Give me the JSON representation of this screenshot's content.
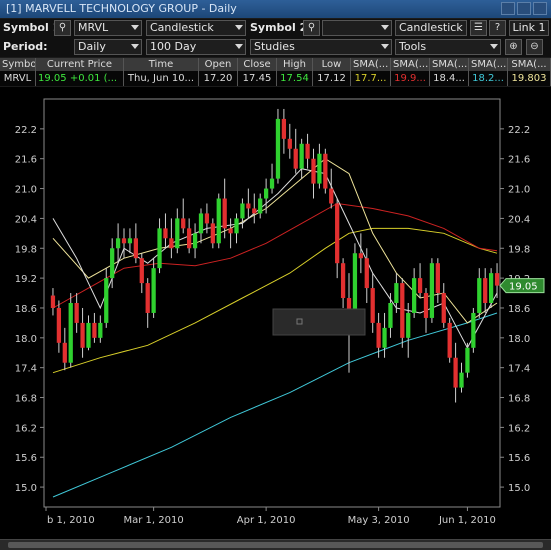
{
  "window": {
    "title": "[1] MARVELL TECHNOLOGY GROUP - Daily"
  },
  "controls": {
    "symbol1_label": "Symbol 1:",
    "symbol1_value": "MRVL",
    "charttype1": "Candlestick",
    "symbol2_label": "Symbol 2:",
    "symbol2_value": "",
    "charttype2": "Candlestick",
    "help_label": "?",
    "link_label": "Link 1",
    "period_label": "Period:",
    "period_value": "Daily",
    "range_value": "100 Day",
    "studies_value": "Studies",
    "tools_value": "Tools"
  },
  "quote": {
    "headers": [
      "Symbol",
      "Current Price",
      "Time",
      "Open",
      "Close",
      "High",
      "Low",
      "SMA(...",
      "SMA(...",
      "SMA(...",
      "SMA(...",
      "SMA(..."
    ],
    "values": [
      "MRVL",
      "19.05",
      "+0.01 (...",
      "Thu, Jun 10...",
      "17.20",
      "17.45",
      "17.54",
      "17.12",
      "17.7...",
      "19.9...",
      "18.4...",
      "18.2...",
      "19.803"
    ]
  },
  "colors": {
    "up": "#2fd12f",
    "down": "#e23030",
    "sma_red": "#cc2222",
    "sma_yellow": "#d8cf2a",
    "sma_light_yellow": "#efe49a",
    "sma_cyan": "#40c8d8",
    "sma_white": "#dddddd",
    "price_flag": "#2f8a2f"
  },
  "chart_data": {
    "type": "candlestick",
    "yaxis_ticks": [
      "22.2",
      "21.6",
      "21.0",
      "20.4",
      "19.8",
      "19.2",
      "18.6",
      "18.0",
      "17.4",
      "16.8",
      "16.2",
      "15.6",
      "15.0"
    ],
    "ylim": [
      14.6,
      22.8
    ],
    "xaxis_ticks": [
      "b 1, 2010",
      "Mar 1, 2010",
      "Apr 1, 2010",
      "May 3, 2010",
      "Jun 1, 2010"
    ],
    "last_price_label": "19.05",
    "candles": [
      [
        18.85,
        19.0,
        18.45,
        18.6
      ],
      [
        18.6,
        18.75,
        17.7,
        17.9
      ],
      [
        17.9,
        18.2,
        17.35,
        17.5
      ],
      [
        17.5,
        18.9,
        17.4,
        18.7
      ],
      [
        18.7,
        18.9,
        18.1,
        18.3
      ],
      [
        18.3,
        18.6,
        17.6,
        17.8
      ],
      [
        17.8,
        18.45,
        17.75,
        18.3
      ],
      [
        18.3,
        18.5,
        17.9,
        18.0
      ],
      [
        18.0,
        18.45,
        17.9,
        18.3
      ],
      [
        18.3,
        19.4,
        18.2,
        19.2
      ],
      [
        19.2,
        20.0,
        19.0,
        19.8
      ],
      [
        19.8,
        20.3,
        19.5,
        20.0
      ],
      [
        20.0,
        20.2,
        19.6,
        19.9
      ],
      [
        19.9,
        20.2,
        19.7,
        20.0
      ],
      [
        20.0,
        20.3,
        19.5,
        19.6
      ],
      [
        19.6,
        19.7,
        18.9,
        19.1
      ],
      [
        19.1,
        19.2,
        18.2,
        18.5
      ],
      [
        18.5,
        19.6,
        18.4,
        19.4
      ],
      [
        19.4,
        20.4,
        19.3,
        20.2
      ],
      [
        20.2,
        20.5,
        19.8,
        20.0
      ],
      [
        20.0,
        20.4,
        19.6,
        19.8
      ],
      [
        19.8,
        20.6,
        19.7,
        20.4
      ],
      [
        20.4,
        20.8,
        20.1,
        20.2
      ],
      [
        20.2,
        20.4,
        19.7,
        19.8
      ],
      [
        19.8,
        20.3,
        19.6,
        20.1
      ],
      [
        20.1,
        20.6,
        19.9,
        20.5
      ],
      [
        20.5,
        20.7,
        20.1,
        20.3
      ],
      [
        20.3,
        20.4,
        19.8,
        19.9
      ],
      [
        19.9,
        20.9,
        19.8,
        20.8
      ],
      [
        20.8,
        21.2,
        20.0,
        20.2
      ],
      [
        20.2,
        20.4,
        19.8,
        20.1
      ],
      [
        20.1,
        20.5,
        19.9,
        20.4
      ],
      [
        20.4,
        20.8,
        20.2,
        20.7
      ],
      [
        20.7,
        21.0,
        20.4,
        20.6
      ],
      [
        20.6,
        20.9,
        20.3,
        20.5
      ],
      [
        20.5,
        20.9,
        20.4,
        20.8
      ],
      [
        20.8,
        21.2,
        20.5,
        21.0
      ],
      [
        21.0,
        21.5,
        20.9,
        21.2
      ],
      [
        21.2,
        22.6,
        21.1,
        22.4
      ],
      [
        22.4,
        22.6,
        21.7,
        22.0
      ],
      [
        22.0,
        22.3,
        21.6,
        21.8
      ],
      [
        21.8,
        22.2,
        21.3,
        21.4
      ],
      [
        21.4,
        22.0,
        21.2,
        21.9
      ],
      [
        21.9,
        22.1,
        21.4,
        21.6
      ],
      [
        21.6,
        21.8,
        20.8,
        21.1
      ],
      [
        21.1,
        21.9,
        21.0,
        21.7
      ],
      [
        21.7,
        21.8,
        20.9,
        21.0
      ],
      [
        21.0,
        21.4,
        20.6,
        20.7
      ],
      [
        20.7,
        20.8,
        19.2,
        19.5
      ],
      [
        19.5,
        19.6,
        18.6,
        18.8
      ],
      [
        18.8,
        19.3,
        17.3,
        18.4
      ],
      [
        18.4,
        19.9,
        18.2,
        19.7
      ],
      [
        19.7,
        20.1,
        19.3,
        19.6
      ],
      [
        19.6,
        19.8,
        18.7,
        19.0
      ],
      [
        19.0,
        19.3,
        18.1,
        18.3
      ],
      [
        18.3,
        18.5,
        17.6,
        17.8
      ],
      [
        17.8,
        18.5,
        17.6,
        18.2
      ],
      [
        18.2,
        18.9,
        18.0,
        18.7
      ],
      [
        18.7,
        19.3,
        18.5,
        19.1
      ],
      [
        19.1,
        19.2,
        17.8,
        18.0
      ],
      [
        18.0,
        18.7,
        17.6,
        18.5
      ],
      [
        18.5,
        19.4,
        18.4,
        19.2
      ],
      [
        19.2,
        19.5,
        18.8,
        18.9
      ],
      [
        18.9,
        19.0,
        18.1,
        18.4
      ],
      [
        18.4,
        19.6,
        18.3,
        19.5
      ],
      [
        19.5,
        19.6,
        18.7,
        18.9
      ],
      [
        18.9,
        19.1,
        18.2,
        18.3
      ],
      [
        18.3,
        18.4,
        17.5,
        17.6
      ],
      [
        17.6,
        17.9,
        16.7,
        17.0
      ],
      [
        17.0,
        17.5,
        16.9,
        17.3
      ],
      [
        17.3,
        17.9,
        17.2,
        17.8
      ],
      [
        17.8,
        18.6,
        17.7,
        18.5
      ],
      [
        18.5,
        19.4,
        18.4,
        19.2
      ],
      [
        19.2,
        19.4,
        18.5,
        18.7
      ],
      [
        18.7,
        19.4,
        18.6,
        19.3
      ],
      [
        19.3,
        19.5,
        18.8,
        19.05
      ]
    ],
    "sma": [
      {
        "color": "#40c8d8",
        "points": [
          [
            0,
            14.8
          ],
          [
            10,
            15.3
          ],
          [
            20,
            15.8
          ],
          [
            30,
            16.4
          ],
          [
            40,
            16.9
          ],
          [
            50,
            17.5
          ],
          [
            60,
            17.95
          ],
          [
            70,
            18.3
          ],
          [
            75,
            18.5
          ]
        ]
      },
      {
        "color": "#d8cf2a",
        "points": [
          [
            0,
            17.3
          ],
          [
            8,
            17.6
          ],
          [
            16,
            17.85
          ],
          [
            24,
            18.3
          ],
          [
            32,
            18.8
          ],
          [
            40,
            19.3
          ],
          [
            46,
            19.8
          ],
          [
            50,
            20.1
          ],
          [
            54,
            20.2
          ],
          [
            60,
            20.2
          ],
          [
            66,
            20.1
          ],
          [
            72,
            19.8
          ],
          [
            75,
            19.7
          ]
        ]
      },
      {
        "color": "#cc2222",
        "points": [
          [
            0,
            18.6
          ],
          [
            6,
            19.0
          ],
          [
            12,
            19.4
          ],
          [
            18,
            19.5
          ],
          [
            24,
            19.45
          ],
          [
            30,
            19.6
          ],
          [
            36,
            19.9
          ],
          [
            42,
            20.3
          ],
          [
            48,
            20.7
          ],
          [
            54,
            20.6
          ],
          [
            60,
            20.45
          ],
          [
            66,
            20.2
          ],
          [
            72,
            19.8
          ],
          [
            75,
            19.75
          ]
        ]
      },
      {
        "color": "#efe49a",
        "points": [
          [
            0,
            20.0
          ],
          [
            6,
            19.2
          ],
          [
            12,
            19.6
          ],
          [
            18,
            19.8
          ],
          [
            24,
            19.9
          ],
          [
            30,
            20.2
          ],
          [
            36,
            20.6
          ],
          [
            42,
            21.2
          ],
          [
            46,
            21.6
          ],
          [
            50,
            21.3
          ],
          [
            54,
            20.1
          ],
          [
            58,
            19.3
          ],
          [
            62,
            18.8
          ],
          [
            66,
            18.9
          ],
          [
            70,
            18.3
          ],
          [
            75,
            18.7
          ]
        ]
      },
      {
        "color": "#dddddd",
        "points": [
          [
            0,
            20.4
          ],
          [
            4,
            19.6
          ],
          [
            8,
            18.6
          ],
          [
            12,
            19.8
          ],
          [
            16,
            19.5
          ],
          [
            20,
            19.9
          ],
          [
            26,
            20.2
          ],
          [
            32,
            20.3
          ],
          [
            38,
            20.9
          ],
          [
            42,
            21.4
          ],
          [
            46,
            21.3
          ],
          [
            50,
            20.3
          ],
          [
            54,
            19.3
          ],
          [
            58,
            18.6
          ],
          [
            62,
            18.5
          ],
          [
            66,
            18.7
          ],
          [
            70,
            17.8
          ],
          [
            75,
            18.9
          ]
        ]
      }
    ]
  }
}
